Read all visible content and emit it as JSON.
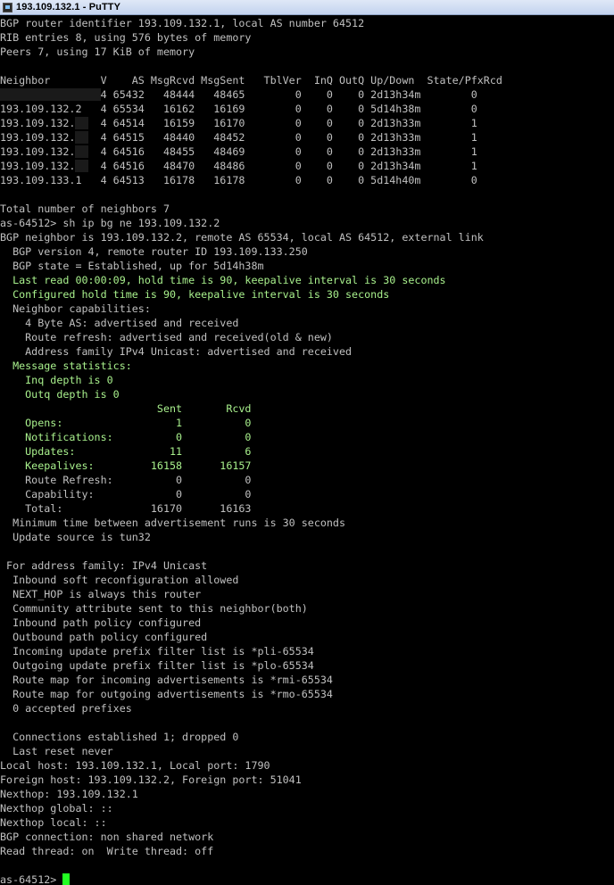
{
  "window": {
    "title": "193.109.132.1 - PuTTY"
  },
  "colors": {
    "background": "#000000",
    "text": "#c0c0c0",
    "highlight": "#a8f08c",
    "cursor": "#22ff22"
  },
  "terminal": {
    "lines": [
      {
        "segments": [
          {
            "t": "BGP router identifier 193.109.132.1, local AS number 64512"
          }
        ]
      },
      {
        "segments": [
          {
            "t": "RIB entries 8, using 576 bytes of memory"
          }
        ]
      },
      {
        "segments": [
          {
            "t": "Peers 7, using 17 KiB of memory"
          }
        ]
      },
      {
        "segments": [
          {
            "t": ""
          }
        ]
      },
      {
        "segments": [
          {
            "t": "Neighbor        V    AS MsgRcvd MsgSent   TblVer  InQ OutQ Up/Down  State/PfxRcd"
          }
        ]
      },
      {
        "segments": [
          {
            "t": "                ",
            "mask": true
          },
          {
            "t": "4 65432   48444   48465        0    0    0 2d13h34m        0"
          }
        ]
      },
      {
        "segments": [
          {
            "t": "193.109.132.2   4 65534   16162   16169        0    0    0 5d14h38m        0"
          }
        ]
      },
      {
        "segments": [
          {
            "t": "193.109.132."
          },
          {
            "t": "  ",
            "mask": true
          },
          {
            "t": "  4 64514   16159   16170        0    0    0 2d13h33m        1"
          }
        ]
      },
      {
        "segments": [
          {
            "t": "193.109.132."
          },
          {
            "t": "  ",
            "mask": true
          },
          {
            "t": "  4 64515   48440   48452        0    0    0 2d13h33m        1"
          }
        ]
      },
      {
        "segments": [
          {
            "t": "193.109.132."
          },
          {
            "t": "  ",
            "mask": true
          },
          {
            "t": "  4 64516   48455   48469        0    0    0 2d13h33m        1"
          }
        ]
      },
      {
        "segments": [
          {
            "t": "193.109.132."
          },
          {
            "t": "  ",
            "mask": true
          },
          {
            "t": "  4 64516   48470   48486        0    0    0 2d13h34m        1"
          }
        ]
      },
      {
        "segments": [
          {
            "t": "193.109.133.1   4 64513   16178   16178        0    0    0 5d14h40m        0"
          }
        ]
      },
      {
        "segments": [
          {
            "t": ""
          }
        ]
      },
      {
        "segments": [
          {
            "t": "Total number of neighbors 7"
          }
        ]
      },
      {
        "segments": [
          {
            "t": "as-64512> sh ip bg ne 193.109.132.2"
          }
        ]
      },
      {
        "segments": [
          {
            "t": "BGP neighbor is 193.109.132.2, remote AS 65534, local AS 64512, external link"
          }
        ]
      },
      {
        "segments": [
          {
            "t": "  BGP version 4, remote router ID 193.109.133.250"
          }
        ]
      },
      {
        "segments": [
          {
            "t": "  BGP state = Established, up for 5d14h38m"
          }
        ]
      },
      {
        "segments": [
          {
            "t": "  Last read 00:00:09, hold time is 90, keepalive interval is 30 seconds",
            "g": true
          }
        ]
      },
      {
        "segments": [
          {
            "t": "  Configured hold time is 90, keepalive interval is 30 seconds",
            "g": true
          }
        ]
      },
      {
        "segments": [
          {
            "t": "  Neighbor capabilities:"
          }
        ]
      },
      {
        "segments": [
          {
            "t": "    4 Byte AS: advertised and received"
          }
        ]
      },
      {
        "segments": [
          {
            "t": "    Route refresh: advertised and received(old & new)"
          }
        ]
      },
      {
        "segments": [
          {
            "t": "    Address family IPv4 Unicast: advertised and received"
          }
        ]
      },
      {
        "segments": [
          {
            "t": "  Message statistics:",
            "g": true
          }
        ]
      },
      {
        "segments": [
          {
            "t": "    Inq depth is 0",
            "g": true
          }
        ]
      },
      {
        "segments": [
          {
            "t": "    Outq depth is 0",
            "g": true
          }
        ]
      },
      {
        "segments": [
          {
            "t": "                         Sent       Rcvd",
            "g": true
          }
        ]
      },
      {
        "segments": [
          {
            "t": "    Opens:                  1          0",
            "g": true
          }
        ]
      },
      {
        "segments": [
          {
            "t": "    Notifications:          0          0",
            "g": true
          }
        ]
      },
      {
        "segments": [
          {
            "t": "    Updates:               11          6",
            "g": true
          }
        ]
      },
      {
        "segments": [
          {
            "t": "    Keepalives:         16158      16157",
            "g": true
          }
        ]
      },
      {
        "segments": [
          {
            "t": "    Route Refresh:          0          0"
          }
        ]
      },
      {
        "segments": [
          {
            "t": "    Capability:             0          0"
          }
        ]
      },
      {
        "segments": [
          {
            "t": "    Total:              16170      16163"
          }
        ]
      },
      {
        "segments": [
          {
            "t": "  Minimum time between advertisement runs is 30 seconds"
          }
        ]
      },
      {
        "segments": [
          {
            "t": "  Update source is tun32"
          }
        ]
      },
      {
        "segments": [
          {
            "t": ""
          }
        ]
      },
      {
        "segments": [
          {
            "t": " For address family: IPv4 Unicast"
          }
        ]
      },
      {
        "segments": [
          {
            "t": "  Inbound soft reconfiguration allowed"
          }
        ]
      },
      {
        "segments": [
          {
            "t": "  NEXT_HOP is always this router"
          }
        ]
      },
      {
        "segments": [
          {
            "t": "  Community attribute sent to this neighbor(both)"
          }
        ]
      },
      {
        "segments": [
          {
            "t": "  Inbound path policy configured"
          }
        ]
      },
      {
        "segments": [
          {
            "t": "  Outbound path policy configured"
          }
        ]
      },
      {
        "segments": [
          {
            "t": "  Incoming update prefix filter list is *pli-65534"
          }
        ]
      },
      {
        "segments": [
          {
            "t": "  Outgoing update prefix filter list is *plo-65534"
          }
        ]
      },
      {
        "segments": [
          {
            "t": "  Route map for incoming advertisements is *rmi-65534"
          }
        ]
      },
      {
        "segments": [
          {
            "t": "  Route map for outgoing advertisements is *rmo-65534"
          }
        ]
      },
      {
        "segments": [
          {
            "t": "  0 accepted prefixes"
          }
        ]
      },
      {
        "segments": [
          {
            "t": ""
          }
        ]
      },
      {
        "segments": [
          {
            "t": "  Connections established 1; dropped 0"
          }
        ]
      },
      {
        "segments": [
          {
            "t": "  Last reset never"
          }
        ]
      },
      {
        "segments": [
          {
            "t": "Local host: 193.109.132.1, Local port: 1790"
          }
        ]
      },
      {
        "segments": [
          {
            "t": "Foreign host: 193.109.132.2, Foreign port: 51041"
          }
        ]
      },
      {
        "segments": [
          {
            "t": "Nexthop: 193.109.132.1"
          }
        ]
      },
      {
        "segments": [
          {
            "t": "Nexthop global: ::"
          }
        ]
      },
      {
        "segments": [
          {
            "t": "Nexthop local: ::"
          }
        ]
      },
      {
        "segments": [
          {
            "t": "BGP connection: non shared network"
          }
        ]
      },
      {
        "segments": [
          {
            "t": "Read thread: on  Write thread: off"
          }
        ]
      },
      {
        "segments": [
          {
            "t": ""
          }
        ]
      },
      {
        "segments": [
          {
            "t": "as-64512> "
          }
        ],
        "cursor": true
      }
    ]
  }
}
